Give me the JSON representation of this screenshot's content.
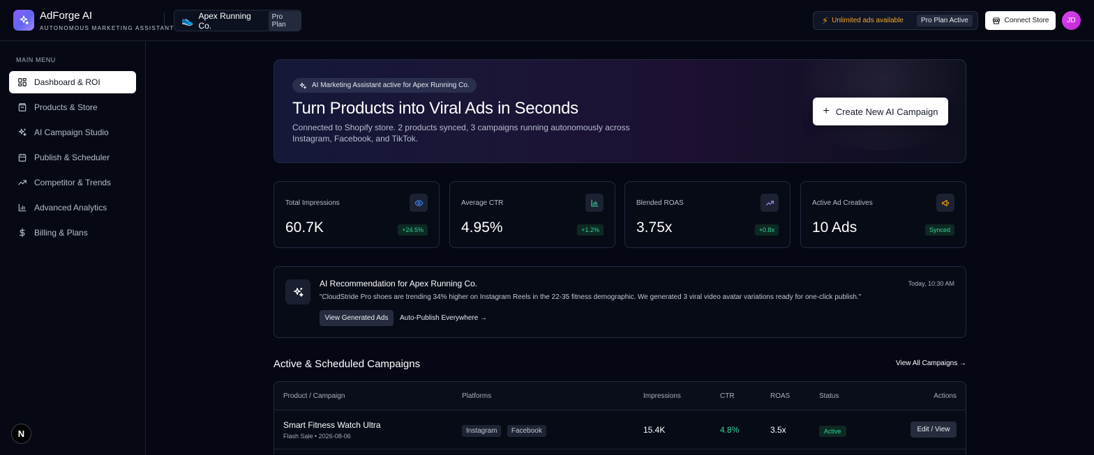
{
  "header": {
    "app_title": "AdForge AI",
    "app_subtitle": "AUTONOMOUS MARKETING ASSISTANT",
    "store_name": "Apex Running Co.",
    "store_plan": "Pro Plan",
    "unlimited_text": "Unlimited ads available",
    "plan_status": "Pro Plan Active",
    "connect_label": "Connect Store",
    "avatar_initials": "JD"
  },
  "sidebar": {
    "heading": "MAIN MENU",
    "items": [
      {
        "label": "Dashboard & ROI",
        "icon": "dashboard-icon",
        "active": true
      },
      {
        "label": "Products & Store",
        "icon": "shopping-bag-icon",
        "active": false
      },
      {
        "label": "AI Campaign Studio",
        "icon": "sparkles-icon",
        "active": false
      },
      {
        "label": "Publish & Scheduler",
        "icon": "calendar-icon",
        "active": false
      },
      {
        "label": "Competitor & Trends",
        "icon": "trending-up-icon",
        "active": false
      },
      {
        "label": "Advanced Analytics",
        "icon": "bar-chart-icon",
        "active": false
      },
      {
        "label": "Billing & Plans",
        "icon": "dollar-icon",
        "active": false
      }
    ],
    "bottom_badge": "N"
  },
  "hero": {
    "assistant_pill": "AI Marketing Assistant active for Apex Running Co.",
    "title": "Turn Products into Viral Ads in Seconds",
    "description": "Connected to Shopify store. 2 products synced, 3 campaigns running autonomously across Instagram, Facebook, and TikTok.",
    "create_label": "Create New AI Campaign"
  },
  "stats": [
    {
      "label": "Total Impressions",
      "value": "60.7K",
      "delta": "+24.5%",
      "icon": "eye-icon",
      "color": "#3b82f6"
    },
    {
      "label": "Average CTR",
      "value": "4.95%",
      "delta": "+1.2%",
      "icon": "bar-chart-icon",
      "color": "#34d399"
    },
    {
      "label": "Blended ROAS",
      "value": "3.75x",
      "delta": "+0.8x",
      "icon": "trending-up-icon",
      "color": "#a78bfa"
    },
    {
      "label": "Active Ad Creatives",
      "value": "10 Ads",
      "delta": "Synced",
      "icon": "megaphone-icon",
      "color": "#f59e0b"
    }
  ],
  "recommendation": {
    "title": "AI Recommendation for Apex Running Co.",
    "time": "Today, 10:30 AM",
    "text": "\"CloudStride Pro shoes are trending 34% higher on Instagram Reels in the 22-35 fitness demographic. We generated 3 viral video avatar variations ready for one-click publish.\"",
    "primary_label": "View Generated Ads",
    "secondary_label": "Auto-Publish Everywhere →"
  },
  "campaigns": {
    "title": "Active & Scheduled Campaigns",
    "view_all": "View All Campaigns →",
    "columns": [
      "Product / Campaign",
      "Platforms",
      "Impressions",
      "CTR",
      "ROAS",
      "Status",
      "Actions"
    ],
    "rows": [
      {
        "name": "Smart Fitness Watch Ultra",
        "sub": "Flash Sale • 2026-08-06",
        "platforms": [
          "Instagram",
          "Facebook"
        ],
        "impressions": "15.4K",
        "ctr": "4.8%",
        "roas": "3.5x",
        "status": "Active",
        "action": "Edit / View"
      }
    ]
  },
  "colors": {
    "background": "#050814",
    "accent_green": "#34d399",
    "accent_orange": "#f59e0b",
    "brand_purple": "#8b5cf6"
  }
}
